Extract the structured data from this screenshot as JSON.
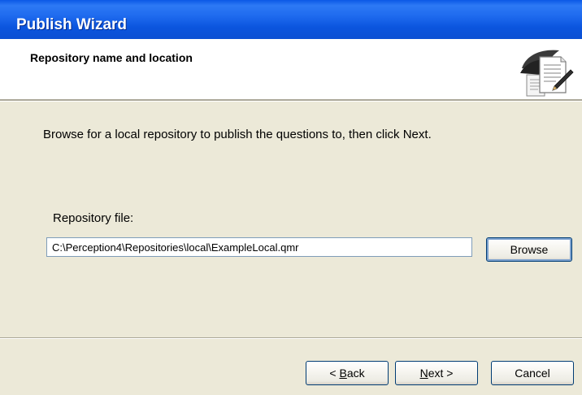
{
  "window": {
    "title": "Publish Wizard"
  },
  "header": {
    "title": "Repository name and location",
    "icon": "publish-document-icon"
  },
  "main": {
    "instruction": "Browse for a local repository to publish the questions to, then click Next.",
    "repository_label": "Repository file:",
    "repository_path": "C:\\Perception4\\Repositories\\local\\ExampleLocal.qmr",
    "browse_label": "Browse"
  },
  "footer": {
    "back_mnemonic": "B",
    "back_rest": "ack",
    "back_prefix": "< ",
    "next_mnemonic": "N",
    "next_rest": "ext >",
    "cancel_label": "Cancel"
  },
  "colors": {
    "titlebar": "#0b55de",
    "dialog_face": "#ece9d8",
    "button_border": "#003c74"
  }
}
